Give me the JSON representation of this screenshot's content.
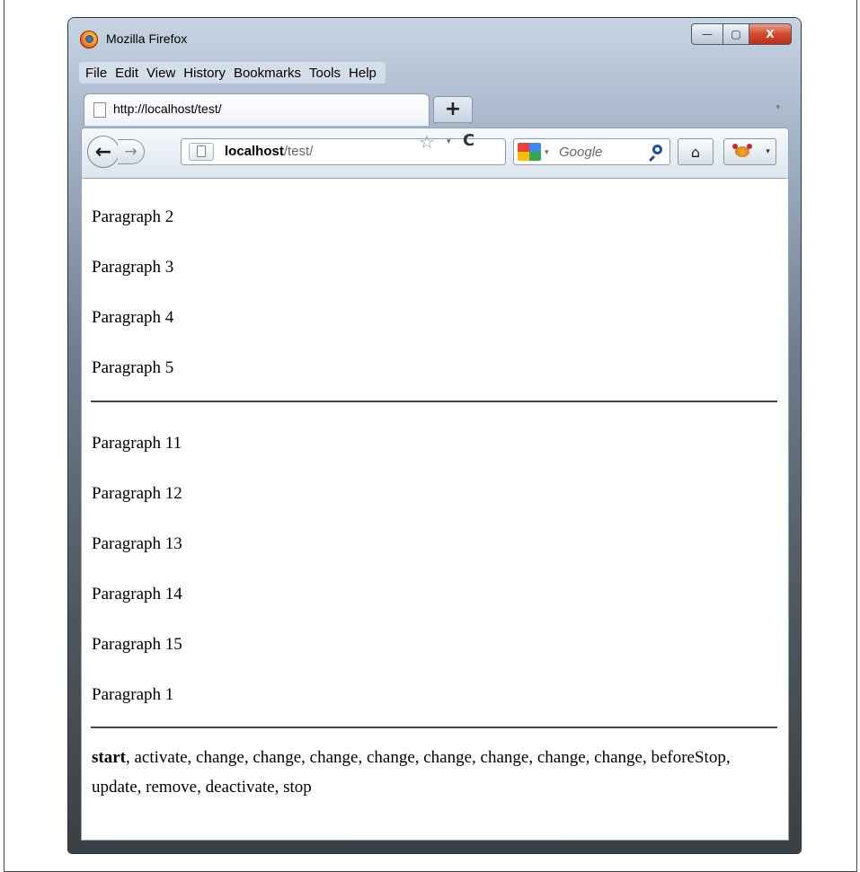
{
  "window": {
    "title": "Mozilla Firefox",
    "controls": {
      "minimize": "—",
      "maximize": "▢",
      "close": "X"
    }
  },
  "menu": {
    "items": [
      "File",
      "Edit",
      "View",
      "History",
      "Bookmarks",
      "Tools",
      "Help"
    ]
  },
  "tab": {
    "label": "http://localhost/test/",
    "new_tab_label": "+",
    "list_arrow": "▾"
  },
  "navbar": {
    "back_icon": "←",
    "forward_icon": "→",
    "url_host": "localhost",
    "url_path": "/test/",
    "star_icon": "☆",
    "dropdown_icon": "▾",
    "reload_icon": "C",
    "search_placeholder": "Google",
    "home_icon": "⌂",
    "icons": [
      "back-icon",
      "forward-icon",
      "site-identity-icon",
      "bookmark-star-icon",
      "reload-icon",
      "google-icon",
      "search-icon",
      "home-icon",
      "firebug-icon"
    ]
  },
  "content": {
    "group1": [
      "Paragraph 2",
      "Paragraph 3",
      "Paragraph 4",
      "Paragraph 5"
    ],
    "group2": [
      "Paragraph 11",
      "Paragraph 12",
      "Paragraph 13",
      "Paragraph 14",
      "Paragraph 15",
      "Paragraph 1"
    ],
    "log_first": "start",
    "log_rest": ", activate, change, change, change, change, change, change, change, change, beforeStop, update, remove, deactivate, stop"
  }
}
